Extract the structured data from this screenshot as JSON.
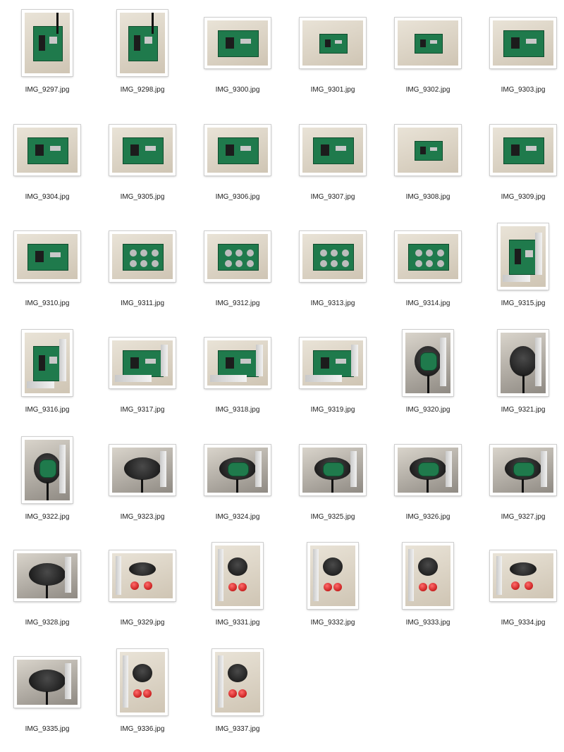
{
  "files": [
    {
      "name": "IMG_9297.jpg",
      "orientation": "portrait",
      "scene": "pcb-hand"
    },
    {
      "name": "IMG_9298.jpg",
      "orientation": "portrait",
      "scene": "pcb-hand"
    },
    {
      "name": "IMG_9300.jpg",
      "orientation": "landscape",
      "scene": "pcb"
    },
    {
      "name": "IMG_9301.jpg",
      "orientation": "landscape",
      "scene": "pcb-small"
    },
    {
      "name": "IMG_9302.jpg",
      "orientation": "landscape",
      "scene": "pcb-small"
    },
    {
      "name": "IMG_9303.jpg",
      "orientation": "landscape",
      "scene": "pcb"
    },
    {
      "name": "IMG_9304.jpg",
      "orientation": "landscape",
      "scene": "pcb"
    },
    {
      "name": "IMG_9305.jpg",
      "orientation": "landscape",
      "scene": "pcb"
    },
    {
      "name": "IMG_9306.jpg",
      "orientation": "landscape",
      "scene": "pcb-top"
    },
    {
      "name": "IMG_9307.jpg",
      "orientation": "landscape",
      "scene": "pcb-top"
    },
    {
      "name": "IMG_9308.jpg",
      "orientation": "landscape",
      "scene": "pcb-small"
    },
    {
      "name": "IMG_9309.jpg",
      "orientation": "landscape",
      "scene": "pcb-top"
    },
    {
      "name": "IMG_9310.jpg",
      "orientation": "landscape",
      "scene": "pcb-top"
    },
    {
      "name": "IMG_9311.jpg",
      "orientation": "landscape",
      "scene": "pcb-back"
    },
    {
      "name": "IMG_9312.jpg",
      "orientation": "landscape",
      "scene": "pcb-back"
    },
    {
      "name": "IMG_9313.jpg",
      "orientation": "landscape",
      "scene": "pcb-back"
    },
    {
      "name": "IMG_9314.jpg",
      "orientation": "landscape",
      "scene": "pcb-back"
    },
    {
      "name": "IMG_9315.jpg",
      "orientation": "portrait",
      "scene": "pcb-ruler"
    },
    {
      "name": "IMG_9316.jpg",
      "orientation": "portrait",
      "scene": "pcb-ruler"
    },
    {
      "name": "IMG_9317.jpg",
      "orientation": "landscape",
      "scene": "pcb-ruler"
    },
    {
      "name": "IMG_9318.jpg",
      "orientation": "landscape",
      "scene": "pcb-ruler"
    },
    {
      "name": "IMG_9319.jpg",
      "orientation": "landscape",
      "scene": "pcb-ruler"
    },
    {
      "name": "IMG_9320.jpg",
      "orientation": "portrait",
      "scene": "puck-open"
    },
    {
      "name": "IMG_9321.jpg",
      "orientation": "portrait",
      "scene": "puck"
    },
    {
      "name": "IMG_9322.jpg",
      "orientation": "portrait",
      "scene": "puck-open"
    },
    {
      "name": "IMG_9323.jpg",
      "orientation": "landscape",
      "scene": "puck"
    },
    {
      "name": "IMG_9324.jpg",
      "orientation": "landscape",
      "scene": "puck-open"
    },
    {
      "name": "IMG_9325.jpg",
      "orientation": "landscape",
      "scene": "puck-open"
    },
    {
      "name": "IMG_9326.jpg",
      "orientation": "landscape",
      "scene": "puck-open"
    },
    {
      "name": "IMG_9327.jpg",
      "orientation": "landscape",
      "scene": "puck-open"
    },
    {
      "name": "IMG_9328.jpg",
      "orientation": "landscape",
      "scene": "puck"
    },
    {
      "name": "IMG_9329.jpg",
      "orientation": "landscape",
      "scene": "red-caps"
    },
    {
      "name": "IMG_9331.jpg",
      "orientation": "portrait",
      "scene": "red-caps"
    },
    {
      "name": "IMG_9332.jpg",
      "orientation": "portrait",
      "scene": "red-caps"
    },
    {
      "name": "IMG_9333.jpg",
      "orientation": "portrait",
      "scene": "red-caps"
    },
    {
      "name": "IMG_9334.jpg",
      "orientation": "landscape",
      "scene": "red-caps"
    },
    {
      "name": "IMG_9335.jpg",
      "orientation": "landscape",
      "scene": "puck"
    },
    {
      "name": "IMG_9336.jpg",
      "orientation": "portrait",
      "scene": "red-caps"
    },
    {
      "name": "IMG_9337.jpg",
      "orientation": "portrait",
      "scene": "red-caps"
    }
  ]
}
